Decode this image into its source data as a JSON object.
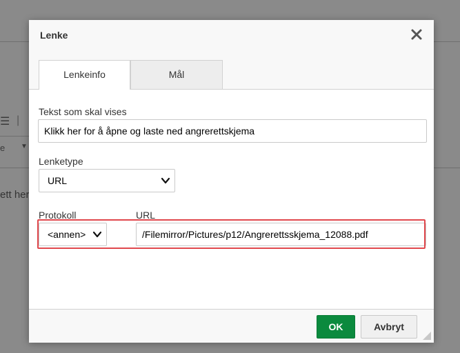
{
  "background": {
    "partial_text": "ett her"
  },
  "dialog": {
    "title": "Lenke",
    "close_icon": "close-icon",
    "tabs": [
      {
        "label": "Lenkeinfo",
        "active": true
      },
      {
        "label": "Mål",
        "active": false
      }
    ],
    "display_text": {
      "label": "Tekst som skal vises",
      "value": "Klikk her for å åpne og laste ned angrerettskjema"
    },
    "link_type": {
      "label": "Lenketype",
      "value": "URL"
    },
    "protocol": {
      "label": "Protokoll",
      "value": "<annen>"
    },
    "url": {
      "label": "URL",
      "value": "/Filemirror/Pictures/p12/Angrerettsskjema_12088.pdf"
    },
    "highlight_color": "#e0474c",
    "buttons": {
      "ok": "OK",
      "cancel": "Avbryt"
    },
    "colors": {
      "ok_bg": "#0b8a3e"
    }
  }
}
